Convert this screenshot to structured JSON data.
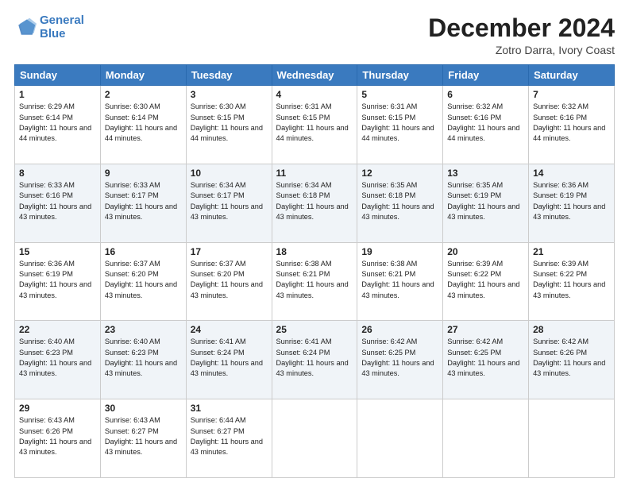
{
  "logo": {
    "line1": "General",
    "line2": "Blue"
  },
  "title": "December 2024",
  "subtitle": "Zotro Darra, Ivory Coast",
  "days_header": [
    "Sunday",
    "Monday",
    "Tuesday",
    "Wednesday",
    "Thursday",
    "Friday",
    "Saturday"
  ],
  "weeks": [
    [
      {
        "day": "1",
        "sunrise": "6:29 AM",
        "sunset": "6:14 PM",
        "daylight": "11 hours and 44 minutes."
      },
      {
        "day": "2",
        "sunrise": "6:30 AM",
        "sunset": "6:14 PM",
        "daylight": "11 hours and 44 minutes."
      },
      {
        "day": "3",
        "sunrise": "6:30 AM",
        "sunset": "6:15 PM",
        "daylight": "11 hours and 44 minutes."
      },
      {
        "day": "4",
        "sunrise": "6:31 AM",
        "sunset": "6:15 PM",
        "daylight": "11 hours and 44 minutes."
      },
      {
        "day": "5",
        "sunrise": "6:31 AM",
        "sunset": "6:15 PM",
        "daylight": "11 hours and 44 minutes."
      },
      {
        "day": "6",
        "sunrise": "6:32 AM",
        "sunset": "6:16 PM",
        "daylight": "11 hours and 44 minutes."
      },
      {
        "day": "7",
        "sunrise": "6:32 AM",
        "sunset": "6:16 PM",
        "daylight": "11 hours and 44 minutes."
      }
    ],
    [
      {
        "day": "8",
        "sunrise": "6:33 AM",
        "sunset": "6:16 PM",
        "daylight": "11 hours and 43 minutes."
      },
      {
        "day": "9",
        "sunrise": "6:33 AM",
        "sunset": "6:17 PM",
        "daylight": "11 hours and 43 minutes."
      },
      {
        "day": "10",
        "sunrise": "6:34 AM",
        "sunset": "6:17 PM",
        "daylight": "11 hours and 43 minutes."
      },
      {
        "day": "11",
        "sunrise": "6:34 AM",
        "sunset": "6:18 PM",
        "daylight": "11 hours and 43 minutes."
      },
      {
        "day": "12",
        "sunrise": "6:35 AM",
        "sunset": "6:18 PM",
        "daylight": "11 hours and 43 minutes."
      },
      {
        "day": "13",
        "sunrise": "6:35 AM",
        "sunset": "6:19 PM",
        "daylight": "11 hours and 43 minutes."
      },
      {
        "day": "14",
        "sunrise": "6:36 AM",
        "sunset": "6:19 PM",
        "daylight": "11 hours and 43 minutes."
      }
    ],
    [
      {
        "day": "15",
        "sunrise": "6:36 AM",
        "sunset": "6:19 PM",
        "daylight": "11 hours and 43 minutes."
      },
      {
        "day": "16",
        "sunrise": "6:37 AM",
        "sunset": "6:20 PM",
        "daylight": "11 hours and 43 minutes."
      },
      {
        "day": "17",
        "sunrise": "6:37 AM",
        "sunset": "6:20 PM",
        "daylight": "11 hours and 43 minutes."
      },
      {
        "day": "18",
        "sunrise": "6:38 AM",
        "sunset": "6:21 PM",
        "daylight": "11 hours and 43 minutes."
      },
      {
        "day": "19",
        "sunrise": "6:38 AM",
        "sunset": "6:21 PM",
        "daylight": "11 hours and 43 minutes."
      },
      {
        "day": "20",
        "sunrise": "6:39 AM",
        "sunset": "6:22 PM",
        "daylight": "11 hours and 43 minutes."
      },
      {
        "day": "21",
        "sunrise": "6:39 AM",
        "sunset": "6:22 PM",
        "daylight": "11 hours and 43 minutes."
      }
    ],
    [
      {
        "day": "22",
        "sunrise": "6:40 AM",
        "sunset": "6:23 PM",
        "daylight": "11 hours and 43 minutes."
      },
      {
        "day": "23",
        "sunrise": "6:40 AM",
        "sunset": "6:23 PM",
        "daylight": "11 hours and 43 minutes."
      },
      {
        "day": "24",
        "sunrise": "6:41 AM",
        "sunset": "6:24 PM",
        "daylight": "11 hours and 43 minutes."
      },
      {
        "day": "25",
        "sunrise": "6:41 AM",
        "sunset": "6:24 PM",
        "daylight": "11 hours and 43 minutes."
      },
      {
        "day": "26",
        "sunrise": "6:42 AM",
        "sunset": "6:25 PM",
        "daylight": "11 hours and 43 minutes."
      },
      {
        "day": "27",
        "sunrise": "6:42 AM",
        "sunset": "6:25 PM",
        "daylight": "11 hours and 43 minutes."
      },
      {
        "day": "28",
        "sunrise": "6:42 AM",
        "sunset": "6:26 PM",
        "daylight": "11 hours and 43 minutes."
      }
    ],
    [
      {
        "day": "29",
        "sunrise": "6:43 AM",
        "sunset": "6:26 PM",
        "daylight": "11 hours and 43 minutes."
      },
      {
        "day": "30",
        "sunrise": "6:43 AM",
        "sunset": "6:27 PM",
        "daylight": "11 hours and 43 minutes."
      },
      {
        "day": "31",
        "sunrise": "6:44 AM",
        "sunset": "6:27 PM",
        "daylight": "11 hours and 43 minutes."
      },
      null,
      null,
      null,
      null
    ]
  ]
}
